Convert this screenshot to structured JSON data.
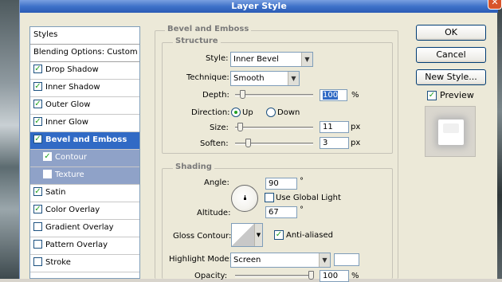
{
  "window": {
    "title": "Layer Style"
  },
  "stylelist": {
    "header": "Styles",
    "blending": "Blending Options: Custom",
    "items": [
      {
        "label": "Drop Shadow",
        "checked": true
      },
      {
        "label": "Inner Shadow",
        "checked": true
      },
      {
        "label": "Outer Glow",
        "checked": true
      },
      {
        "label": "Inner Glow",
        "checked": true
      },
      {
        "label": "Bevel and Emboss",
        "checked": true
      },
      {
        "label": "Contour",
        "checked": true
      },
      {
        "label": "Texture",
        "checked": false
      },
      {
        "label": "Satin",
        "checked": true
      },
      {
        "label": "Color Overlay",
        "checked": true
      },
      {
        "label": "Gradient Overlay",
        "checked": false
      },
      {
        "label": "Pattern Overlay",
        "checked": false
      },
      {
        "label": "Stroke",
        "checked": false
      }
    ]
  },
  "bevel": {
    "section_title": "Bevel and Emboss",
    "structure_title": "Structure",
    "style_label": "Style:",
    "style_value": "Inner Bevel",
    "technique_label": "Technique:",
    "technique_value": "Smooth",
    "depth_label": "Depth:",
    "depth_value": "100",
    "depth_unit": "%",
    "direction_label": "Direction:",
    "direction_up": "Up",
    "direction_down": "Down",
    "size_label": "Size:",
    "size_value": "11",
    "size_unit": "px",
    "soften_label": "Soften:",
    "soften_value": "3",
    "soften_unit": "px"
  },
  "shading": {
    "title": "Shading",
    "angle_label": "Angle:",
    "angle_value": "90",
    "angle_unit": "°",
    "global_light_label": "Use Global Light",
    "altitude_label": "Altitude:",
    "altitude_value": "67",
    "altitude_unit": "°",
    "gloss_label": "Gloss Contour:",
    "antialiased_label": "Anti-aliased",
    "highlight_label": "Highlight Mode:",
    "highlight_value": "Screen",
    "highlight_color": "#ffffff",
    "opacity_label": "Opacity:",
    "opacity_value": "100",
    "opacity_unit": "%"
  },
  "buttons": {
    "ok": "OK",
    "cancel": "Cancel",
    "new_style": "New Style...",
    "preview": "Preview"
  }
}
